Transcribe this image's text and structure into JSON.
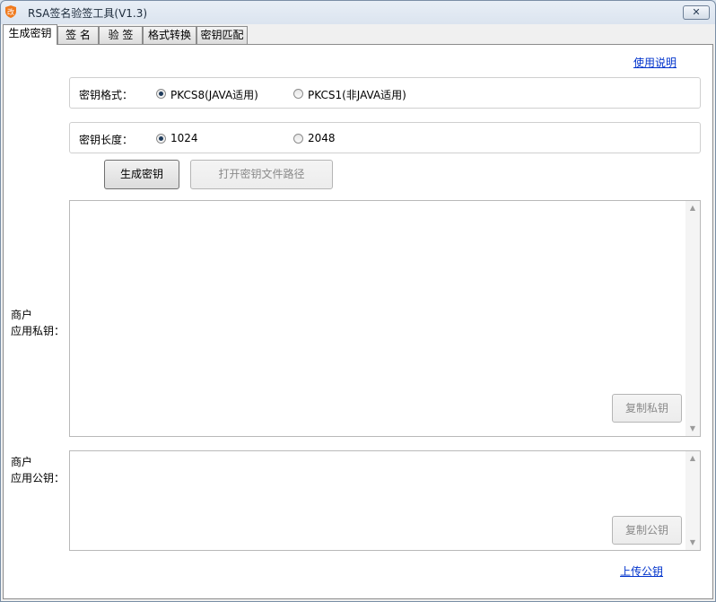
{
  "window": {
    "title": "RSA签名验签工具(V1.3)",
    "close_glyph": "✕"
  },
  "tabs": [
    {
      "label": "生成密钥",
      "active": true
    },
    {
      "label": "签 名",
      "active": false
    },
    {
      "label": "验 签",
      "active": false
    },
    {
      "label": "格式转换",
      "active": false
    },
    {
      "label": "密钥匹配",
      "active": false
    }
  ],
  "help_link": "使用说明",
  "key_format": {
    "label": "密钥格式：",
    "options": [
      {
        "label": "PKCS8(JAVA适用)",
        "checked": true
      },
      {
        "label": "PKCS1(非JAVA适用)",
        "checked": false
      }
    ]
  },
  "key_length": {
    "label": "密钥长度：",
    "options": [
      {
        "label": "1024",
        "checked": true
      },
      {
        "label": "2048",
        "checked": false
      }
    ]
  },
  "buttons": {
    "generate": "生成密钥",
    "open_path": "打开密钥文件路径",
    "copy_private": "复制私钥",
    "copy_public": "复制公钥"
  },
  "private_key": {
    "label_line1": "商户",
    "label_line2": "应用私钥：",
    "value": ""
  },
  "public_key": {
    "label_line1": "商户",
    "label_line2": "应用公钥：",
    "value": ""
  },
  "upload_link": "上传公钥",
  "colors": {
    "link": "#0033cc",
    "app_icon": "#f07a1e"
  }
}
